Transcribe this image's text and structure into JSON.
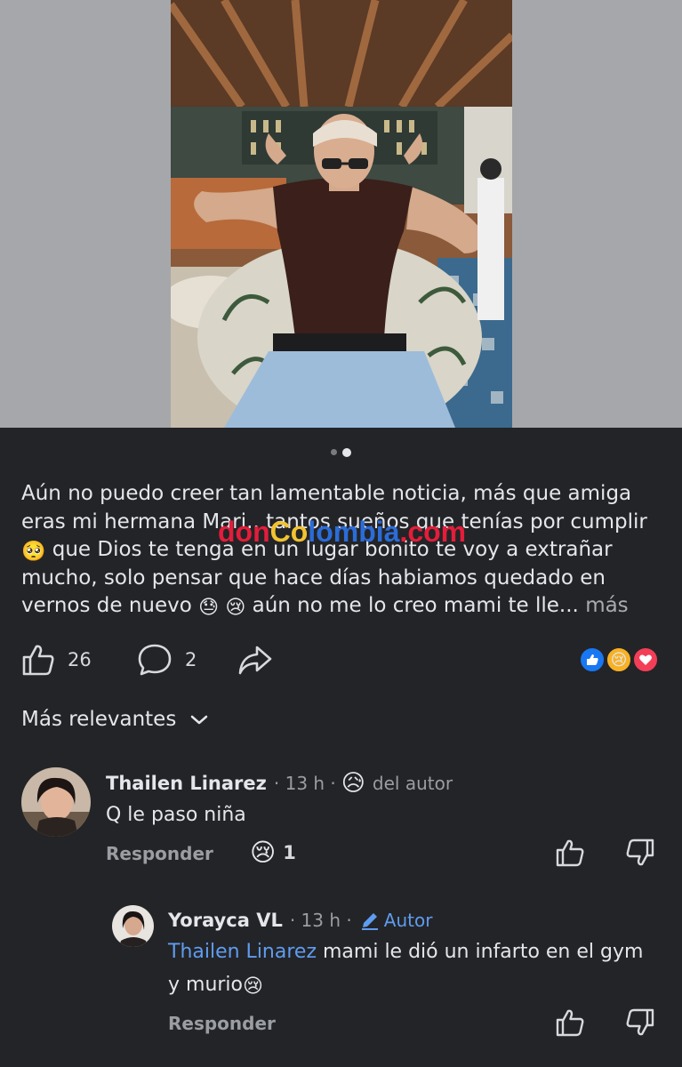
{
  "post": {
    "caption_text": "Aún no puedo creer tan lamentable noticia, más que amiga eras mi hermana Mari.. tantos sueños que tenías por cumplir ",
    "caption_text_2": " que Dios te tenga en un lugar bonito te voy a extrañar mucho, solo pensar que hace días habiamos quedado en vernos de nuevo ",
    "caption_text_3": " aún no me lo creo mami te lle...",
    "more_label": "más",
    "emoji_pleading": "🥺",
    "emoji_sweat": "😓",
    "emoji_cry": "😢",
    "like_count": "26",
    "comment_count": "2"
  },
  "watermark": {
    "part1": "don",
    "part2": "Co",
    "part3": "lombia",
    "part4": ".com"
  },
  "sort": {
    "label": "Más relevantes"
  },
  "comments": [
    {
      "name": "Thailen Linarez",
      "time": "· 13 h ·",
      "reaction_emoji": "😥",
      "badge": "del autor",
      "text": "Q le paso niña",
      "reply_label": "Responder",
      "reaction_count_emoji": "😢",
      "reaction_count": "1"
    },
    {
      "name": "Yorayca VL",
      "time": "· 13 h ·",
      "badge": "Autor",
      "mention": "Thailen Linarez",
      "text": " mami le dió un infarto en el gym y murio",
      "text_emoji": "😢",
      "reply_label": "Responder"
    }
  ],
  "colors": {
    "background": "#232427",
    "text": "#e4e6eb",
    "muted": "#9a9da2",
    "link": "#5f9cf0",
    "like_blue": "#1877f2",
    "love_red": "#f33e58"
  }
}
